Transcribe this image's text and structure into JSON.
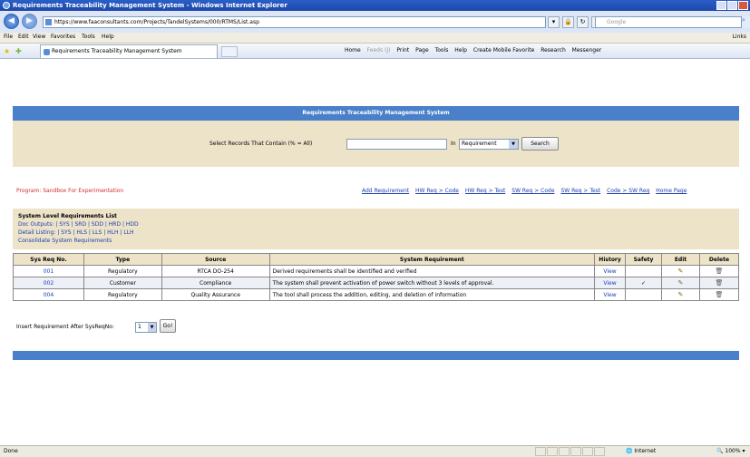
{
  "window": {
    "title": "Requirements Traceability Management System - Windows Internet Explorer"
  },
  "browser": {
    "url": "https://www.faaconsultants.com/Projects/TandelSystems/000/RTMS/List.asp",
    "search_placeholder": "Google",
    "menu": [
      "File",
      "Edit",
      "View",
      "Favorites",
      "Tools",
      "Help"
    ],
    "links_label": "Links",
    "tab_title": "Requirements Traceability Management System",
    "commands": [
      "Home",
      "Feeds (J)",
      "Print",
      "Page",
      "Tools",
      "Help",
      "Create Mobile Favorite",
      "Research",
      "Messenger"
    ],
    "status": "Done",
    "zone": "Internet",
    "zoom": "100%"
  },
  "app": {
    "banner_title": "Requirements Traceability Management System",
    "search": {
      "label": "Select Records That Contain (% = All)",
      "value": "",
      "in_label": "In",
      "field_selected": "Requirement",
      "button": "Search"
    },
    "program": "Program: Sandbox For Experimentation",
    "top_links": [
      "Add Requirement",
      "HW Req > Code",
      "HW Req > Test",
      "SW Req > Code",
      "SW Req > Test",
      "Code > SW Req",
      "Home Page"
    ],
    "list_panel": {
      "heading": "System Level Requirements List",
      "doc_outputs_label": "Doc Outputs:",
      "doc_outputs": "| SYS | SRD | SDD | HRD | HDD",
      "detail_label": "Detail Listing:",
      "detail": "| SYS | HLS | LLS | HLH | LLH",
      "consolidate": "Consolidate System Requirements"
    },
    "table": {
      "headers": [
        "Sys Req No.",
        "Type",
        "Source",
        "System Requirement",
        "History",
        "Safety",
        "Edit",
        "Delete"
      ],
      "rows": [
        {
          "no": "001",
          "type": "Regulatory",
          "source": "RTCA DO-254",
          "requirement": "Derived requirements shall be identified and verified",
          "history": "View",
          "safety": ""
        },
        {
          "no": "002",
          "type": "Customer",
          "source": "Compliance",
          "requirement": "The system shall prevent activation of power switch without 3 levels of approval.",
          "history": "View",
          "safety": "✓"
        },
        {
          "no": "004",
          "type": "Regulatory",
          "source": "Quality Assurance",
          "requirement": "The tool shall process the addition, editing, and deletion of information",
          "history": "View",
          "safety": ""
        }
      ]
    },
    "insert": {
      "label": "Insert Requirement After SysReqNo:",
      "selected": "1",
      "button": "Go!"
    }
  }
}
